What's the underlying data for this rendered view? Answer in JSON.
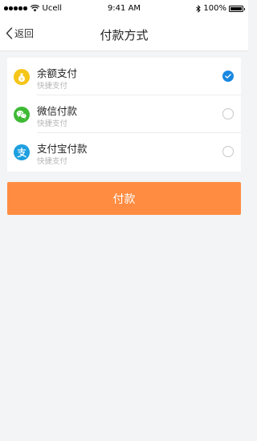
{
  "status_bar": {
    "carrier": "Ucell",
    "time": "9:41 AM",
    "battery_text": "100%"
  },
  "nav": {
    "back_label": "返回",
    "title": "付款方式"
  },
  "payment_methods": [
    {
      "name": "余额支付",
      "subtitle": "快捷支付",
      "icon": "money-bag-icon",
      "icon_color": "#f5c518",
      "selected": true
    },
    {
      "name": "微信付款",
      "subtitle": "快捷支付",
      "icon": "wechat-icon",
      "icon_color": "#3fba35",
      "selected": false
    },
    {
      "name": "支付宝付款",
      "subtitle": "快捷支付",
      "icon": "alipay-icon",
      "icon_color": "#1d9fe0",
      "selected": false
    }
  ],
  "pay_button": {
    "label": "付款"
  },
  "colors": {
    "accent_orange": "#ff8c41",
    "check_blue": "#1a88e0",
    "background": "#f3f4f6"
  }
}
